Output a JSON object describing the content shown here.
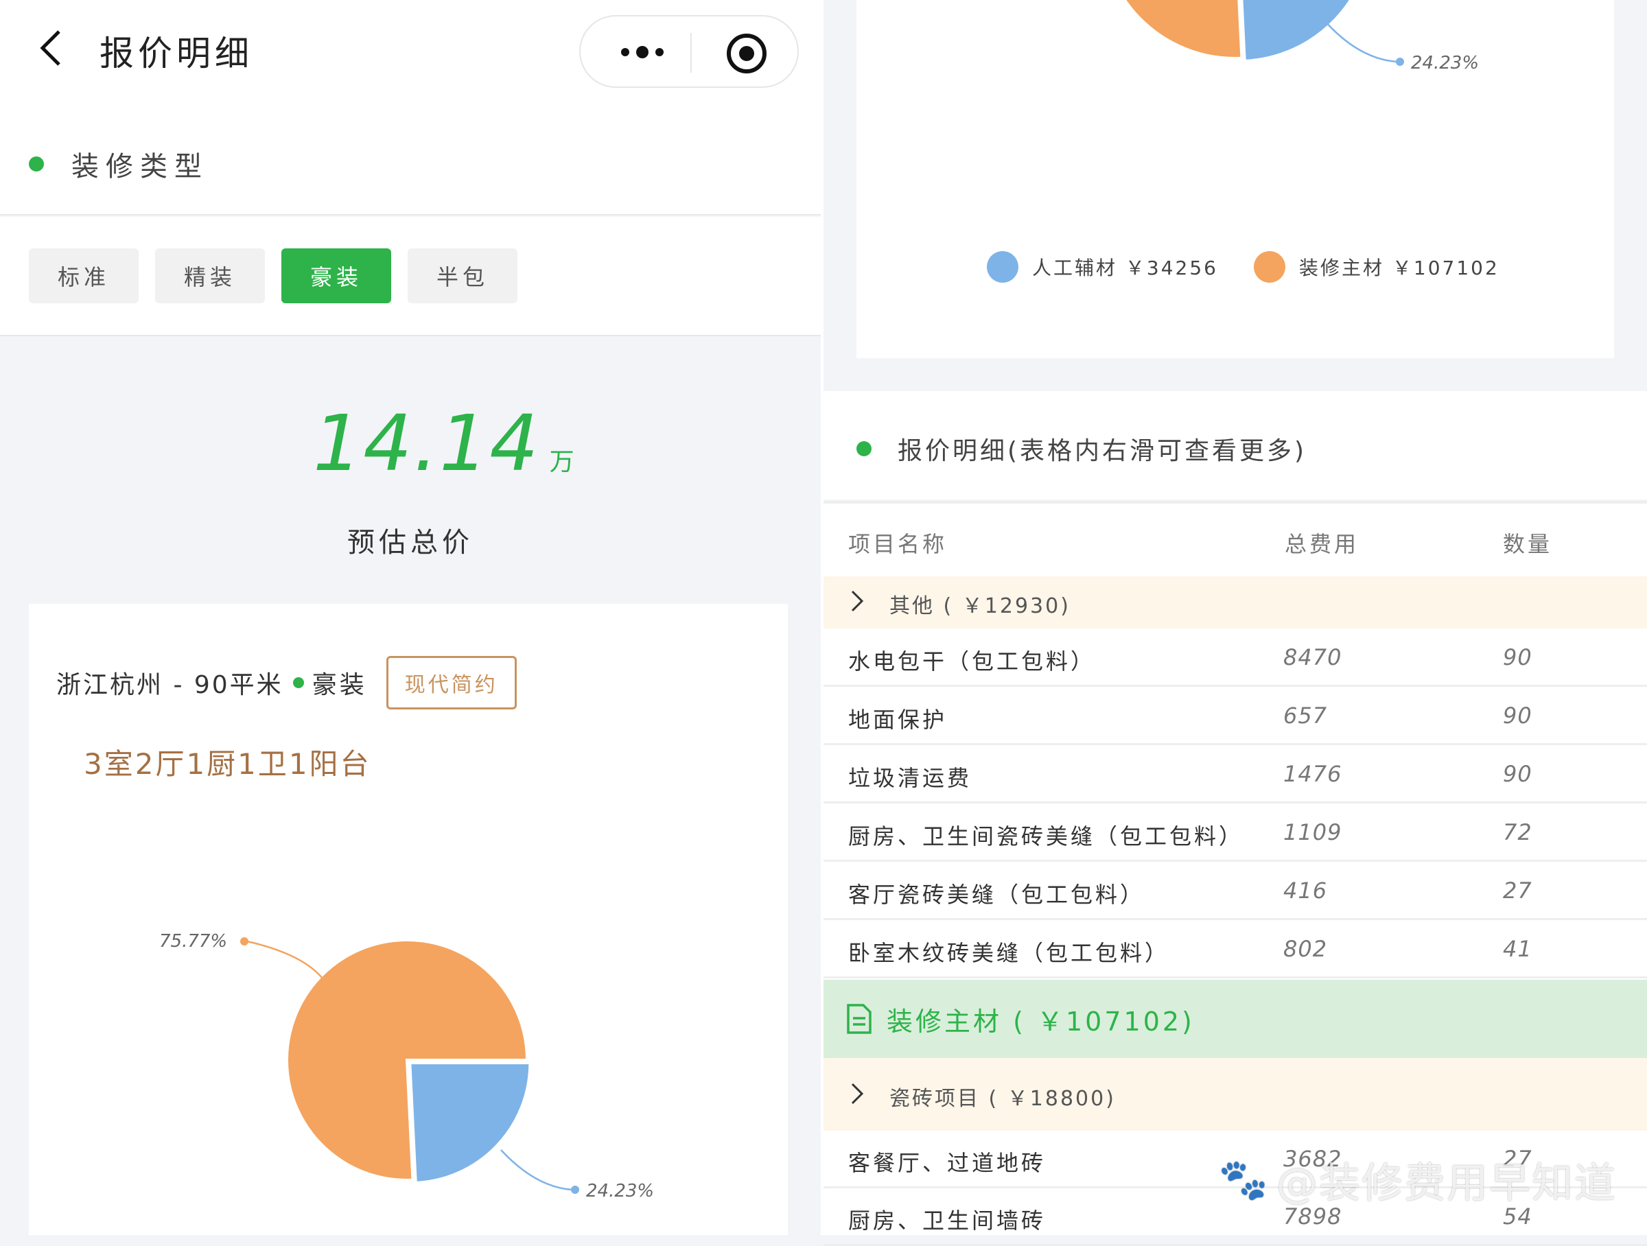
{
  "nav": {
    "title": "报价明细"
  },
  "decor_type": {
    "label": "装修类型",
    "options": [
      "标准",
      "精装",
      "豪装",
      "半包"
    ],
    "selected": "豪装"
  },
  "estimate": {
    "value": "14.14",
    "unit": "万",
    "label": "预估总价"
  },
  "house": {
    "location": "浙江杭州 - 90平米",
    "level": "豪装",
    "style": "现代简约",
    "layout": "3室2厅1厨1卫1阳台"
  },
  "chart_data": [
    {
      "type": "pie",
      "series": [
        {
          "name": "人工辅材",
          "amount": 34256,
          "percent": 24.23,
          "color": "#7eb3e8"
        },
        {
          "name": "装修主材",
          "amount": 107102,
          "percent": 75.77,
          "color": "#f4a45e"
        }
      ],
      "labels": [
        "75.77%",
        "24.23%"
      ]
    },
    {
      "type": "pie",
      "series": [
        {
          "name": "人工辅材",
          "amount": 34256,
          "percent": 24.23,
          "color": "#7eb3e8"
        },
        {
          "name": "装修主材",
          "amount": 107102,
          "percent": 75.77,
          "color": "#f4a45e"
        }
      ],
      "labels": [
        "24.23%"
      ],
      "legend": [
        "人工辅材 ￥34256",
        "装修主材 ￥107102"
      ]
    }
  ],
  "detail": {
    "title": "报价明细(表格内右滑可查看更多)",
    "columns": [
      "项目名称",
      "总费用",
      "数量"
    ],
    "group1": "其他 ( ￥12930)",
    "rows1": [
      {
        "name": "水电包干（包工包料）",
        "cost": "8470",
        "qty": "90"
      },
      {
        "name": "地面保护",
        "cost": "657",
        "qty": "90"
      },
      {
        "name": "垃圾清运费",
        "cost": "1476",
        "qty": "90"
      },
      {
        "name": "厨房、卫生间瓷砖美缝（包工包料）",
        "cost": "1109",
        "qty": "72"
      },
      {
        "name": "客厅瓷砖美缝（包工包料）",
        "cost": "416",
        "qty": "27"
      },
      {
        "name": "卧室木纹砖美缝（包工包料）",
        "cost": "802",
        "qty": "41"
      }
    ],
    "section": "装修主材 ( ￥107102)",
    "group2": "瓷砖项目 ( ￥18800)",
    "rows2": [
      {
        "name": "客餐厅、过道地砖",
        "cost": "3682",
        "qty": "27"
      },
      {
        "name": "厨房、卫生间墙砖",
        "cost": "7898",
        "qty": "54"
      }
    ]
  },
  "watermark": "@装修费用早知道",
  "colors": {
    "accent": "#2db34a",
    "orange": "#f4a45e",
    "blue": "#7eb3e8",
    "tag": "#c8935f"
  }
}
